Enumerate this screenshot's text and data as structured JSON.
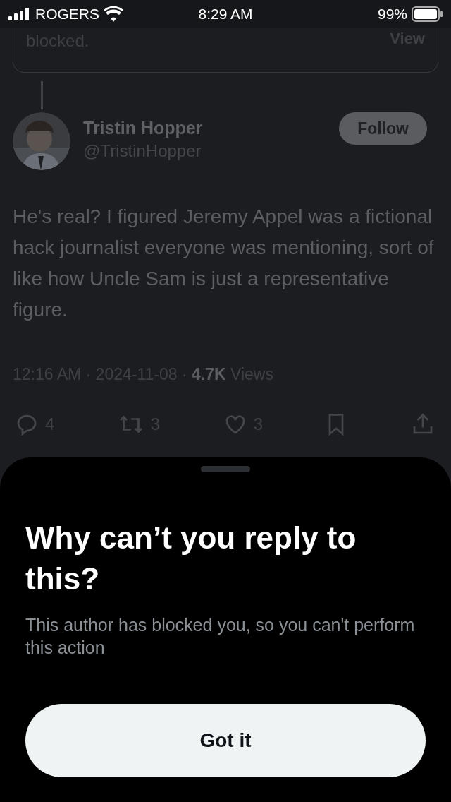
{
  "status_bar": {
    "carrier": "ROGERS",
    "time": "8:29 AM",
    "battery": "99%"
  },
  "quoted_card": {
    "text": "blocked.",
    "action": "View"
  },
  "author": {
    "name": "Tristin Hopper",
    "handle": "@TristinHopper",
    "follow_button": "Follow"
  },
  "tweet_text": "He's real? I figured Jeremy Appel was a fictional hack journalist everyone was mentioning, sort of like how Uncle Sam is just a representative figure.",
  "meta": "12:16 AM · 2024-11-08 · **4.7K** Views",
  "actions": [
    {
      "kind": "reply",
      "count": "4"
    },
    {
      "kind": "repost",
      "count": "3"
    },
    {
      "kind": "like",
      "count": "3"
    },
    {
      "kind": "bookmark"
    },
    {
      "kind": "share"
    }
  ],
  "sheet": {
    "title": "Why can’t you reply to this?",
    "body": "This author has blocked you, so you can't perform this action",
    "button": "Got it"
  }
}
